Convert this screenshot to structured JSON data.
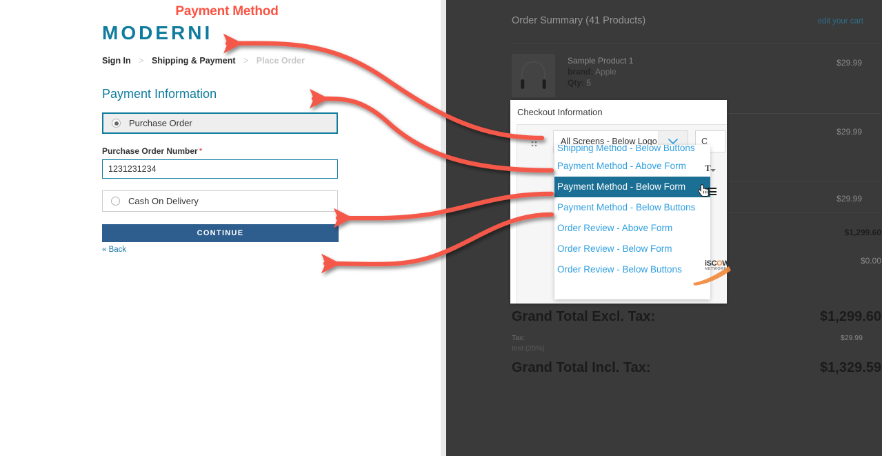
{
  "annotation": {
    "title": "Payment Method",
    "title_color": "#fa5343",
    "arrow_color": "#f4584a",
    "arrow_count": 4
  },
  "checkout": {
    "logo": "MODERNI",
    "logo_color": "#0f7c9e",
    "breadcrumb": {
      "steps": [
        {
          "label": "Sign In",
          "state": "complete"
        },
        {
          "label": "Shipping & Payment",
          "state": "current"
        },
        {
          "label": "Place Order",
          "state": "upcoming"
        }
      ],
      "separator": ">"
    },
    "section_heading": "Payment Information",
    "payment_methods": [
      {
        "label": "Purchase Order",
        "selected": true
      },
      {
        "label": "Cash On Delivery",
        "selected": false
      }
    ],
    "po_field": {
      "label": "Purchase Order Number",
      "required_marker": "*",
      "value": "1231231234",
      "placeholder": ""
    },
    "continue_label": "CONTINUE",
    "back_label": "« Back"
  },
  "order_summary": {
    "title": "Order Summary (41 Products)",
    "edit_link": "edit your cart",
    "items": [
      {
        "name": "Sample Product 1",
        "attr_label": "brand:",
        "attr_value": "Apple",
        "qty_label": "Qty:",
        "qty_value": "5",
        "price": "$29.99"
      },
      {
        "name": "",
        "attr_label": "",
        "attr_value": "",
        "qty_label": "",
        "qty_value": "",
        "price": "$29.99"
      },
      {
        "name": "",
        "attr_label": "",
        "attr_value": "",
        "qty_label": "",
        "qty_value": "",
        "price": "$29.99"
      }
    ],
    "totals": [
      {
        "label": "",
        "value": "$1,299.60",
        "bold": true
      },
      {
        "label": "",
        "value": "$0.00",
        "bold": false
      }
    ],
    "grand_total_excl": {
      "label": "Grand Total Excl. Tax:",
      "value": "$1,299.60"
    },
    "tax": {
      "label": "Tax:",
      "rate": "test (20%)",
      "value": "$29.99"
    },
    "grand_total_incl": {
      "label": "Grand Total Incl. Tax:",
      "value": "$1,329.59"
    }
  },
  "checkout_information_panel": {
    "title": "Checkout Information",
    "drag_handle_icon": "drag-handle-icon",
    "select": {
      "value": "All Screens - Below Logo",
      "caret_icon": "chevron-down-icon"
    },
    "second_control_value": "C",
    "font_icon": "T",
    "menu_icon": "hamburger-icon",
    "cursor_icon": "pointer-cursor",
    "options": [
      {
        "label": "Shipping Method - Below Buttons",
        "active": false,
        "clipped": true
      },
      {
        "label": "Payment Method - Above Form",
        "active": false,
        "clipped": false
      },
      {
        "label": "Payment Method - Below Form",
        "active": true,
        "clipped": false
      },
      {
        "label": "Payment Method - Below Buttons",
        "active": false,
        "clipped": false
      },
      {
        "label": "Order Review - Above Form",
        "active": false,
        "clipped": false
      },
      {
        "label": "Order Review - Below Form",
        "active": false,
        "clipped": false
      },
      {
        "label": "Order Review - Below Buttons",
        "active": false,
        "clipped": false
      }
    ],
    "watermark": {
      "text": "iSCOW",
      "sub": "NETWORK"
    }
  },
  "colors": {
    "brand_teal": "#0f7c9e",
    "link_blue": "#2f9fe0",
    "highlight_blue": "#1b6f95",
    "button_blue": "#2e5e8e",
    "overlay_dark": "#3a3a3a",
    "annotation_red": "#f4584a"
  }
}
